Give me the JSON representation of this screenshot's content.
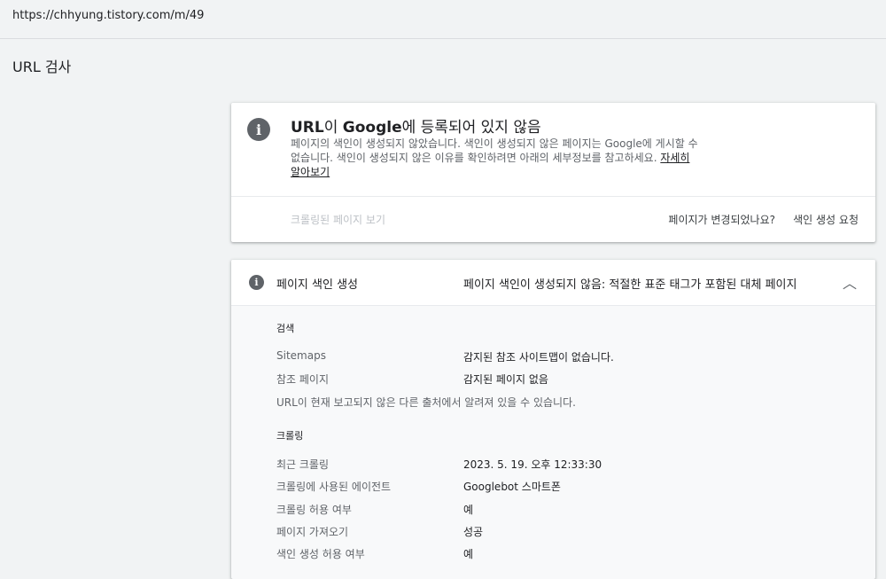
{
  "topbar": {
    "url": "https://chhyung.tistory.com/m/49"
  },
  "page": {
    "title": "URL 검사"
  },
  "status_card": {
    "title_prefix": "URL",
    "title_mid": "이 ",
    "title_brand": "Google",
    "title_suffix": "에 등록되어 있지 않음",
    "description": "페이지의 색인이 생성되지 않았습니다. 색인이 생성되지 않은 페이지는 Google에 게시할 수 없습니다. 색인이 생성되지 않은 이유를 확인하려면 아래의 세부정보를 참고하세요. ",
    "learn_more": "자세히 알아보기",
    "view_crawled": "크롤링된 페이지 보기",
    "changed_question": "페이지가 변경되었나요?",
    "request_indexing": "색인 생성 요청"
  },
  "index_card": {
    "label": "페이지 색인 생성",
    "status": "페이지 색인이 생성되지 않음: 적절한 표준 태그가 포함된 대체 페이지",
    "discovery": {
      "title": "검색",
      "rows": [
        {
          "label": "Sitemaps",
          "value": "감지된 참조 사이트맵이 없습니다."
        },
        {
          "label": "참조 페이지",
          "value": "감지된 페이지 없음"
        }
      ],
      "note": "URL이 현재 보고되지 않은 다른 출처에서 알려져 있을 수 있습니다."
    },
    "crawl": {
      "title": "크롤링",
      "rows": [
        {
          "label": "최근 크롤링",
          "value": "2023. 5. 19. 오후 12:33:30"
        },
        {
          "label": "크롤링에 사용된 에이전트",
          "value": "Googlebot 스마트폰"
        },
        {
          "label": "크롤링 허용 여부",
          "value": "예"
        },
        {
          "label": "페이지 가져오기",
          "value": "성공"
        },
        {
          "label": "색인 생성 허용 여부",
          "value": "예"
        }
      ]
    }
  },
  "icons": {
    "info": "i",
    "chevron": "︿"
  }
}
